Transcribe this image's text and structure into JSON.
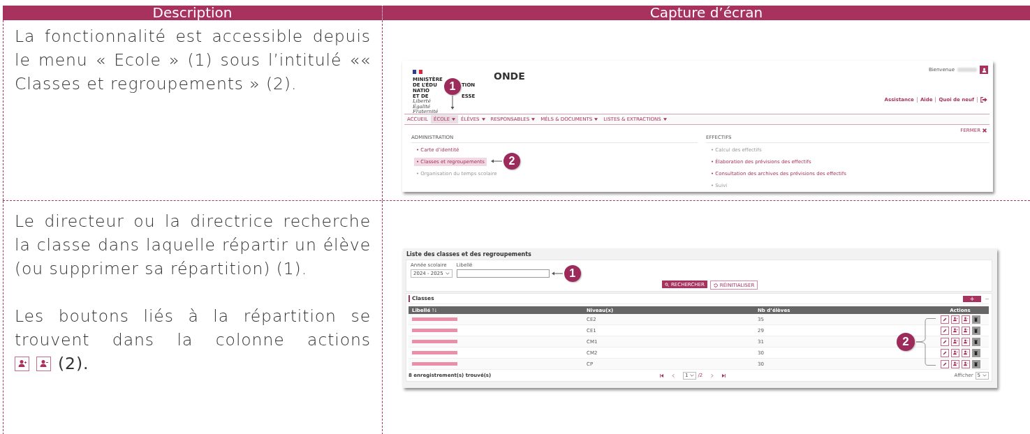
{
  "table_header": {
    "columns": [
      "Description",
      "Capture d’écran"
    ]
  },
  "rows": [
    {
      "description": [
        {
          "text": "La fonctionnalité est accessible depuis le menu « Ecole » (1) sous l’intitulé «« Classes et regroupements » (2)."
        }
      ],
      "screenshot": {
        "kind": "menu",
        "logo_lines": [
          [
            "MINISTÈRE"
          ],
          [
            "DE L’ÉDU",
            "TION"
          ],
          [
            "NATIO"
          ],
          [
            "ET DE",
            "ESSE"
          ]
        ],
        "motto": [
          "Liberté",
          "Égalité",
          "Fraternité"
        ],
        "app_title": "ONDE",
        "welcome": "Bienvenue",
        "links": [
          "Assistance",
          "Aide",
          "Quoi de neuf"
        ],
        "nav": [
          {
            "label": "ACCUEIL",
            "dropdown": false,
            "selected": false
          },
          {
            "label": "ÉCOLE",
            "dropdown": true,
            "selected": true
          },
          {
            "label": "ÉLÈVES",
            "dropdown": true,
            "selected": false
          },
          {
            "label": "RESPONSABLES",
            "dropdown": true,
            "selected": false
          },
          {
            "label": "MÉLS & DOCUMENTS",
            "dropdown": true,
            "selected": false
          },
          {
            "label": "LISTES & EXTRACTIONS",
            "dropdown": true,
            "selected": false
          }
        ],
        "close": "FERMER",
        "sections": [
          {
            "title": "ADMINISTRATION",
            "items": [
              {
                "label": "• Carte d’identité",
                "disabled": false,
                "selected": false
              },
              {
                "label": "• Classes et regroupements",
                "disabled": false,
                "selected": true
              },
              {
                "label": "• Organisation du temps scolaire",
                "disabled": true,
                "selected": false
              }
            ]
          },
          {
            "title": "EFFECTIFS",
            "items": [
              {
                "label": "• Calcul des effectifs",
                "disabled": true,
                "selected": false
              },
              {
                "label": "• Élaboration des prévisions des effectifs",
                "disabled": false,
                "selected": false
              },
              {
                "label": "• Consultation des archives des prévisions des effectifs",
                "disabled": false,
                "selected": false
              },
              {
                "label": "• Suivi",
                "disabled": true,
                "selected": false
              }
            ]
          }
        ],
        "callouts": [
          "1",
          "2"
        ]
      }
    },
    {
      "description": [
        {
          "text": "Le directeur ou la directrice recherche la classe dans laquelle répartir un élève (ou supprimer sa répartition) (1)."
        },
        {
          "text": "Les boutons liés à la répartition se trouvent dans la colonne actions",
          "suffix": "(2)."
        }
      ],
      "screenshot": {
        "kind": "list",
        "title": "Liste des classes et des regroupements",
        "filters": [
          {
            "label": "Année scolaire",
            "kind": "select",
            "value": "2024 - 2025"
          },
          {
            "label": "Libellé",
            "kind": "text"
          }
        ],
        "buttons": [
          {
            "label": "RECHERCHER",
            "kind": "primary"
          },
          {
            "label": "RÉINITIALISER",
            "kind": "secondary"
          }
        ],
        "section": "Classes",
        "add_button": "+",
        "columns": [
          "Libellé",
          "Niveau(x)",
          "Nb d’élèves",
          "Actions"
        ],
        "rows": [
          {
            "level": "CE2",
            "count": "35"
          },
          {
            "level": "CE1",
            "count": "29"
          },
          {
            "level": "CM1",
            "count": "31"
          },
          {
            "level": "CM2",
            "count": "30"
          },
          {
            "level": "CP",
            "count": "30"
          }
        ],
        "footer": "8 enregistrement(s) trouvé(s)",
        "page": "1",
        "pages": "/2",
        "per_page_label": "Afficher",
        "per_page": "5",
        "callouts": [
          "1",
          "2"
        ]
      }
    }
  ]
}
